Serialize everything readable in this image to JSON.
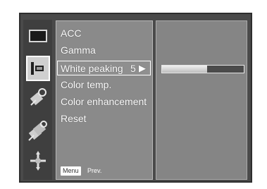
{
  "menu": {
    "items": [
      {
        "label": "ACC"
      },
      {
        "label": "Gamma"
      },
      {
        "label": "White peaking",
        "value": "5",
        "arrow": "▶"
      },
      {
        "label": "Color temp."
      },
      {
        "label": "Color enhancement"
      },
      {
        "label": "Reset"
      }
    ],
    "selected_index": 2
  },
  "adjustment": {
    "name": "White peaking",
    "level_fraction": 0.55
  },
  "footer": {
    "menu_tag": "Menu",
    "prev_label": "Prev."
  },
  "icons": [
    "screen-icon",
    "picture-icon",
    "audio-icon",
    "options-icon",
    "setup-icon"
  ]
}
